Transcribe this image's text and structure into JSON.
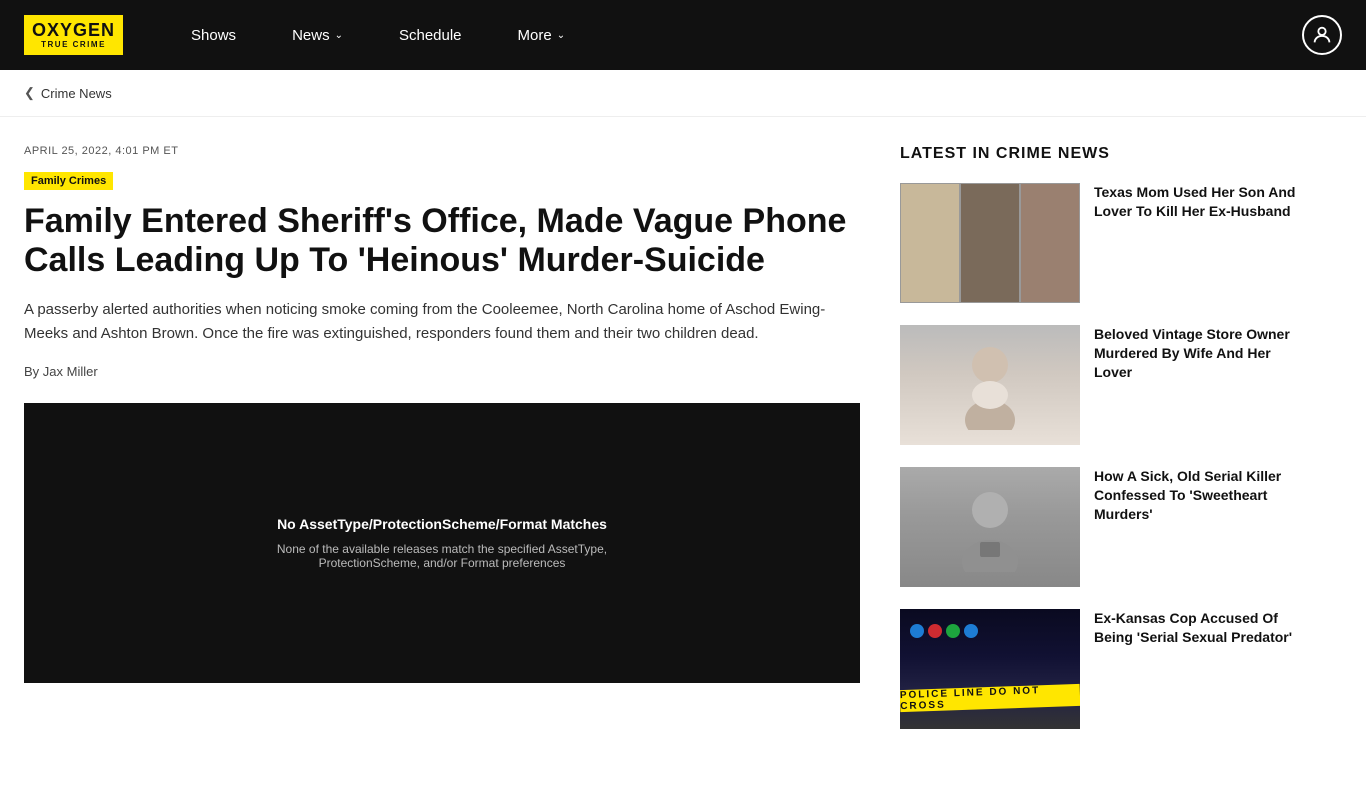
{
  "nav": {
    "logo_line1": "OXYGEN",
    "logo_line2": "TRUE CRIME",
    "links": [
      {
        "label": "Shows",
        "hasDropdown": false
      },
      {
        "label": "News",
        "hasDropdown": true
      },
      {
        "label": "Schedule",
        "hasDropdown": false
      },
      {
        "label": "More",
        "hasDropdown": true
      }
    ]
  },
  "breadcrumb": {
    "chevron": "❮",
    "label": "Crime News"
  },
  "article": {
    "date": "APRIL 25, 2022, 4:01 PM ET",
    "category": "Family Crimes",
    "title": "Family Entered Sheriff's Office, Made Vague Phone Calls Leading Up To 'Heinous' Murder-Suicide",
    "summary": "A passerby alerted authorities when noticing smoke coming from the Cooleemee, North Carolina home of Aschod Ewing-Meeks and Ashton Brown. Once the fire was extinguished, responders found them and their two children dead.",
    "author": "By Jax Miller",
    "video_error_title": "No AssetType/ProtectionScheme/Format Matches",
    "video_error_text": "None of the available releases match the specified AssetType, ProtectionScheme, and/or Format preferences"
  },
  "sidebar": {
    "title": "LATEST IN CRIME NEWS",
    "items": [
      {
        "thumb_type": "three-faces",
        "text": "Texas Mom Used Her Son And Lover To Kill Her Ex-Husband"
      },
      {
        "thumb_type": "white-beard",
        "text": "Beloved Vintage Store Owner Murdered By Wife And Her Lover"
      },
      {
        "thumb_type": "bw-man",
        "text": "How A Sick, Old Serial Killer Confessed To 'Sweetheart Murders'"
      },
      {
        "thumb_type": "police-line",
        "text": "Ex-Kansas Cop Accused Of Being 'Serial Sexual Predator'"
      }
    ]
  }
}
